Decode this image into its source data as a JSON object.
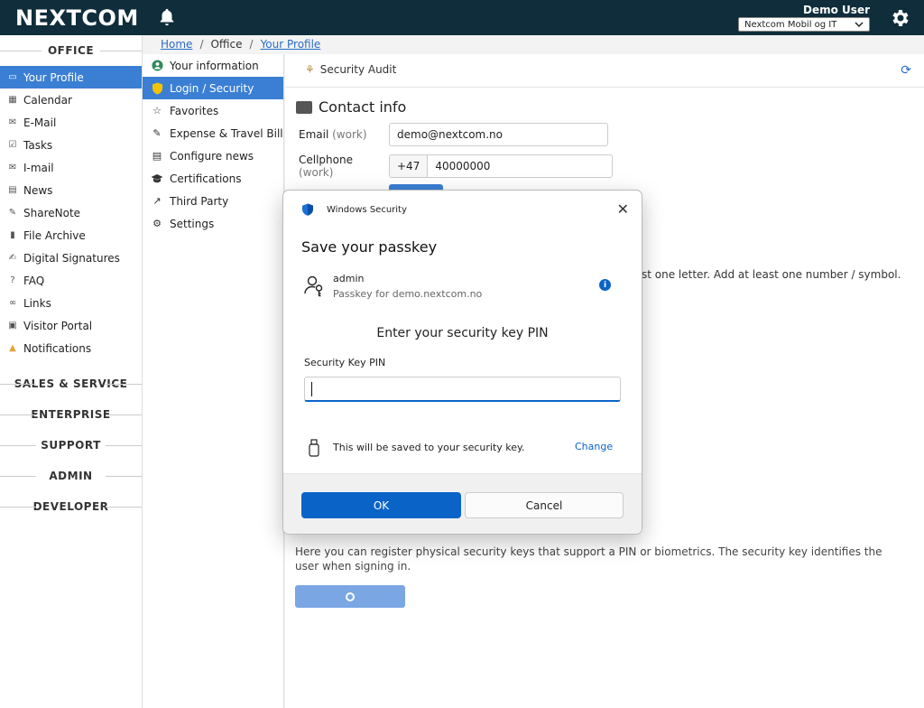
{
  "header": {
    "logo": "NEXTCOM",
    "user_name": "Demo User",
    "company": "Nextcom Mobil og IT",
    "icons": [
      "bell-icon",
      "gear-icon",
      "chevron-down-icon"
    ]
  },
  "sidebar": {
    "sections": [
      "OFFICE",
      "SALES & SERVICE",
      "ENTERPRISE",
      "SUPPORT",
      "ADMIN",
      "DEVELOPER"
    ],
    "items": [
      {
        "label": "Your Profile",
        "icon": "profile-icon"
      },
      {
        "label": "Calendar",
        "icon": "calendar-icon"
      },
      {
        "label": "E-Mail",
        "icon": "email-icon"
      },
      {
        "label": "Tasks",
        "icon": "tasks-icon"
      },
      {
        "label": "I-mail",
        "icon": "imail-icon"
      },
      {
        "label": "News",
        "icon": "news-icon"
      },
      {
        "label": "ShareNote",
        "icon": "sharenote-icon"
      },
      {
        "label": "File Archive",
        "icon": "file-archive-icon"
      },
      {
        "label": "Digital Signatures",
        "icon": "signature-icon"
      },
      {
        "label": "FAQ",
        "icon": "faq-icon"
      },
      {
        "label": "Links",
        "icon": "link-icon"
      },
      {
        "label": "Visitor Portal",
        "icon": "visitor-portal-icon"
      },
      {
        "label": "Notifications",
        "icon": "notifications-icon"
      }
    ]
  },
  "breadcrumb": {
    "home": "Home",
    "office": "Office",
    "profile": "Your Profile",
    "sep": "/"
  },
  "submenu": {
    "items": [
      {
        "label": "Your information",
        "icon": "user-circle-icon"
      },
      {
        "label": "Login / Security",
        "icon": "shield-icon"
      },
      {
        "label": "Favorites",
        "icon": "star-icon"
      },
      {
        "label": "Expense & Travel Bill",
        "icon": "expense-icon"
      },
      {
        "label": "Configure news",
        "icon": "news-config-icon"
      },
      {
        "label": "Certifications",
        "icon": "graduation-cap-icon"
      },
      {
        "label": "Third Party",
        "icon": "external-link-icon"
      },
      {
        "label": "Settings",
        "icon": "gear-icon"
      }
    ]
  },
  "main": {
    "tab_audit": "Security Audit",
    "contact_title": "Contact info",
    "email_label": "Email",
    "email_qualifier": "(work)",
    "email_value": "demo@nextcom.no",
    "cell_label": "Cellphone",
    "cell_qualifier": "(work)",
    "cell_prefix": "+47",
    "cell_value": "40000000",
    "password_hint": "st one letter. Add at least one number / symbol.",
    "security_key_desc": "Here you can register physical security keys that support a PIN or biometrics. The security key identifies the user when signing in."
  },
  "dialog": {
    "app_title": "Windows Security",
    "title": "Save your passkey",
    "account_name": "admin",
    "account_sub": "Passkey for demo.nextcom.no",
    "info_glyph": "i",
    "pin_heading": "Enter your security key PIN",
    "pin_label": "Security Key PIN",
    "pin_value": "",
    "save_note": "This will be saved to your security key.",
    "change_label": "Change",
    "ok_label": "OK",
    "cancel_label": "Cancel",
    "close_glyph": "✕"
  },
  "colors": {
    "header_bg": "#0f2d3a",
    "accent": "#3b7fd4",
    "dialog_primary": "#0a64c8"
  }
}
